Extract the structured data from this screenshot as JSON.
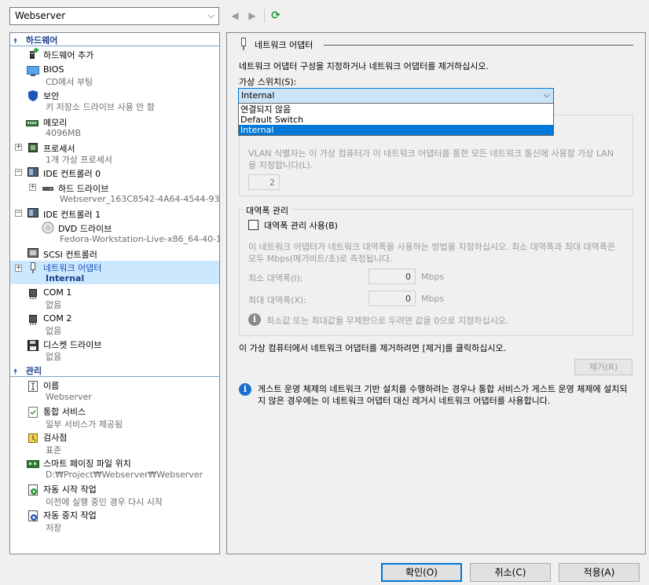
{
  "toolbar": {
    "vm_name": "Webserver",
    "back_icon": "back-arrow-icon",
    "forward_icon": "forward-arrow-icon",
    "refresh_icon": "refresh-icon"
  },
  "tree": {
    "hardware_header": "하드웨어",
    "management_header": "관리",
    "hardware_items": [
      {
        "name": "하드웨어 추가",
        "sub": ""
      },
      {
        "name": "BIOS",
        "sub": "CD에서 부팅"
      },
      {
        "name": "보안",
        "sub": "키 저장소 드라이브 사용 안 함"
      },
      {
        "name": "메모리",
        "sub": "4096MB"
      },
      {
        "name": "프로세서",
        "sub": "1개 가상 프로세서"
      },
      {
        "name": "IDE 컨트롤러 0",
        "sub": ""
      },
      {
        "name": "하드 드라이브",
        "sub": "Webserver_163C8542-4A64-4544-93..."
      },
      {
        "name": "IDE 컨트롤러 1",
        "sub": ""
      },
      {
        "name": "DVD 드라이브",
        "sub": "Fedora-Workstation-Live-x86_64-40-1..."
      },
      {
        "name": "SCSI 컨트롤러",
        "sub": ""
      },
      {
        "name": "네트워크 어댑터",
        "sub": "Internal"
      },
      {
        "name": "COM 1",
        "sub": "없음"
      },
      {
        "name": "COM 2",
        "sub": "없음"
      },
      {
        "name": "디스켓 드라이브",
        "sub": "없음"
      }
    ],
    "management_items": [
      {
        "name": "이름",
        "sub": "Webserver"
      },
      {
        "name": "통합 서비스",
        "sub": "일부 서비스가 제공됨"
      },
      {
        "name": "검사점",
        "sub": "표준"
      },
      {
        "name": "스마트 페이징 파일 위치",
        "sub": "D:₩Project₩Webserver₩Webserver"
      },
      {
        "name": "자동 시작 작업",
        "sub": "이전에 실행 중인 경우 다시 시작"
      },
      {
        "name": "자동 중지 작업",
        "sub": "저장"
      }
    ]
  },
  "panel": {
    "title": "네트워크 어댑터",
    "description": "네트워크 어댑터 구성을 지정하거나 네트워크 어댑터를 제거하십시오.",
    "switch_label": "가상 스위치(S):",
    "switch_value": "Internal",
    "switch_options": [
      "연결되지 않음",
      "Default Switch",
      "Internal"
    ],
    "vlan_description": "VLAN 식별자는 이 가상 컴퓨터가 이 네트워크 어댑터를 통한 모든 네트워크 통신에 사용할 가상 LAN을 지정합니다(L).",
    "vlan_id": "2",
    "bandwidth_legend": "대역폭 관리",
    "bandwidth_checkbox": "대역폭 관리 사용(B)",
    "bandwidth_checked": false,
    "bandwidth_description": "이 네트워크 어댑터가 네트워크 대역폭을 사용하는 방법을 지정하십시오. 최소 대역폭과 최대 대역폭은 모두 Mbps(메가비트/초)로 측정됩니다.",
    "min_label": "최소 대역폭(I):",
    "min_value": "0",
    "max_label": "최대 대역폭(X):",
    "max_value": "0",
    "unit": "Mbps",
    "bandwidth_note": "최소값 또는 최대값을 무제한으로 두려면 값을 0으로 지정하십시오.",
    "remove_description": "이 가상 컴퓨터에서 네트워크 어댑터를 제거하려면 [제거]를 클릭하십시오.",
    "remove_button": "제거(R)",
    "legacy_note": "게스트 운영 체제의 네트워크 기반 설치를 수행하려는 경우나 통합 서비스가 게스트 운영 체제에 설치되지 않은 경우에는 이 네트워크 어댑터 대신 레거시 네트워크 어댑터를 사용합니다."
  },
  "buttons": {
    "ok": "확인(O)",
    "cancel": "취소(C)",
    "apply": "적용(A)"
  },
  "colors": {
    "accent": "#0078d7",
    "selection": "#cce8ff",
    "section_header": "#1a3f8a",
    "info_icon": "#1a6fd1"
  }
}
